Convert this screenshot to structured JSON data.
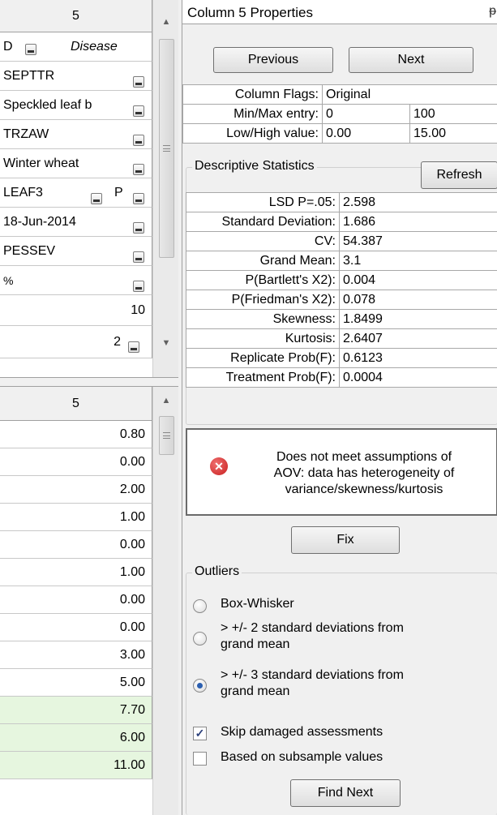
{
  "top_grid": {
    "header": "5",
    "rows": [
      {
        "text": "D",
        "text2": "Disease"
      },
      {
        "text": "SEPTTR"
      },
      {
        "text": "Speckled leaf b"
      },
      {
        "text": "TRZAW"
      },
      {
        "text": "Winter wheat"
      },
      {
        "text": "LEAF3",
        "text2": "P"
      },
      {
        "text": "18-Jun-2014"
      },
      {
        "text": "PESSEV"
      },
      {
        "text": "%"
      },
      {
        "text": "10"
      },
      {
        "text": "2"
      }
    ]
  },
  "bottom_grid": {
    "header": "5",
    "values": [
      "0.80",
      "0.00",
      "2.00",
      "1.00",
      "0.00",
      "1.00",
      "0.00",
      "0.00",
      "3.00",
      "5.00",
      "7.70",
      "6.00",
      "11.00"
    ],
    "highlight_color": "#e6f6df"
  },
  "panel": {
    "title": "Column 5 Properties",
    "pin_icon": "pushpin-icon",
    "previous_label": "Previous",
    "next_label": "Next",
    "column_flags_label": "Column Flags:",
    "column_flags_value": "Original",
    "minmax_label": "Min/Max entry:",
    "min_entry": "0",
    "max_entry": "100",
    "lowhigh_label": "Low/High value:",
    "low_value": "0.00",
    "high_value": "15.00"
  },
  "stats": {
    "group_label": "Descriptive Statistics",
    "refresh_label": "Refresh",
    "rows": [
      {
        "label": "LSD P=.05:",
        "value": "2.598"
      },
      {
        "label": "Standard Deviation:",
        "value": "1.686"
      },
      {
        "label": "CV:",
        "value": "54.387"
      },
      {
        "label": "Grand Mean:",
        "value": "3.1"
      },
      {
        "label": "P(Bartlett's X2):",
        "value": "0.004"
      },
      {
        "label": "P(Friedman's X2):",
        "value": "0.078"
      },
      {
        "label": "Skewness:",
        "value": "1.8499"
      },
      {
        "label": "Kurtosis:",
        "value": "2.6407"
      },
      {
        "label": "Replicate Prob(F):",
        "value": "0.6123"
      },
      {
        "label": "Treatment Prob(F):",
        "value": "0.0004"
      }
    ]
  },
  "message": {
    "icon": "error-icon",
    "line1": "Does not meet assumptions of",
    "line2": "AOV: data has heterogeneity of",
    "line3": "variance/skewness/kurtosis",
    "fix_label": "Fix"
  },
  "outliers": {
    "group_label": "Outliers",
    "options": [
      {
        "line1": "Box-Whisker",
        "line2": "",
        "selected": false
      },
      {
        "line1": "> +/- 2 standard deviations from",
        "line2": "grand mean",
        "selected": false
      },
      {
        "line1": "> +/- 3 standard deviations from",
        "line2": "grand mean",
        "selected": true
      }
    ],
    "skip_damaged_label": "Skip damaged assessments",
    "skip_damaged_checked": true,
    "subsample_label": "Based on subsample values",
    "subsample_checked": false,
    "find_next_label": "Find Next"
  }
}
